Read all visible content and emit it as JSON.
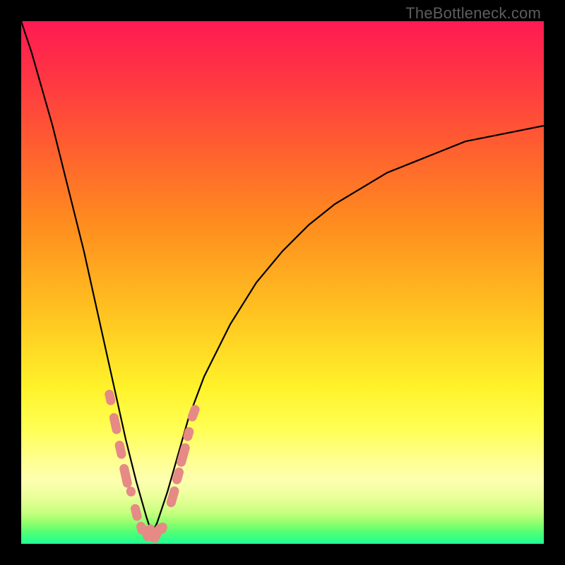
{
  "watermark": "TheBottleneck.com",
  "colors": {
    "background_frame": "#000000",
    "gradient_top": "#ff1a52",
    "gradient_bottom": "#1fff95",
    "curve": "#000000",
    "marker": "#e58a85",
    "watermark_text": "#5d5d5d"
  },
  "chart_data": {
    "type": "line",
    "title": "",
    "xlabel": "",
    "ylabel": "",
    "xlim": [
      0,
      100
    ],
    "ylim": [
      0,
      100
    ],
    "grid": false,
    "note": "Bottleneck-style V-curve. y-values are approximate bottleneck percentages read from the vertical gradient (0 = green bottom, 100 = red top). Minimum near x≈25.",
    "series": [
      {
        "name": "bottleneck-curve",
        "x": [
          0,
          2,
          4,
          6,
          8,
          10,
          12,
          14,
          16,
          18,
          20,
          22,
          24,
          25,
          26,
          28,
          30,
          32,
          35,
          40,
          45,
          50,
          55,
          60,
          65,
          70,
          75,
          80,
          85,
          90,
          95,
          100
        ],
        "y": [
          100,
          94,
          87,
          80,
          72,
          64,
          56,
          47,
          38,
          29,
          20,
          12,
          5,
          2,
          4,
          10,
          17,
          24,
          32,
          42,
          50,
          56,
          61,
          65,
          68,
          71,
          73,
          75,
          77,
          78,
          79,
          80
        ]
      }
    ],
    "markers": {
      "name": "highlighted-points",
      "note": "Pink capsule markers clustered near the curve's minimum.",
      "points": [
        {
          "x": 17,
          "y": 28
        },
        {
          "x": 18,
          "y": 23
        },
        {
          "x": 19,
          "y": 18
        },
        {
          "x": 20,
          "y": 13
        },
        {
          "x": 21,
          "y": 10
        },
        {
          "x": 22,
          "y": 6
        },
        {
          "x": 23,
          "y": 3
        },
        {
          "x": 24,
          "y": 2
        },
        {
          "x": 25,
          "y": 2
        },
        {
          "x": 26,
          "y": 2
        },
        {
          "x": 27,
          "y": 3
        },
        {
          "x": 29,
          "y": 9
        },
        {
          "x": 30,
          "y": 13
        },
        {
          "x": 31,
          "y": 17
        },
        {
          "x": 32,
          "y": 21
        },
        {
          "x": 33,
          "y": 25
        }
      ]
    }
  }
}
